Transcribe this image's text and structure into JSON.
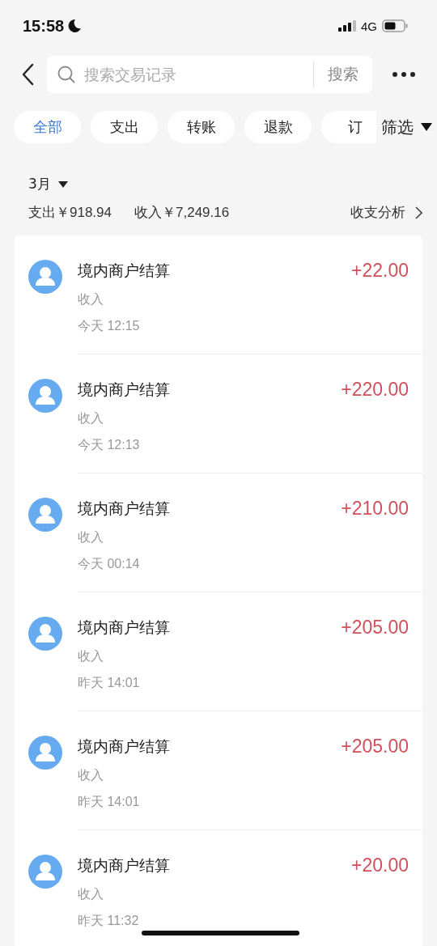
{
  "status_bar": {
    "time": "15:58",
    "network": "4G"
  },
  "search": {
    "placeholder": "搜索交易记录",
    "button": "搜索"
  },
  "filters": [
    {
      "label": "全部",
      "selected": true
    },
    {
      "label": "支出",
      "selected": false
    },
    {
      "label": "转账",
      "selected": false
    },
    {
      "label": "退款",
      "selected": false
    },
    {
      "label": "订",
      "selected": false
    }
  ],
  "filter_menu": "筛选",
  "summary": {
    "month": "3月",
    "expense": "支出￥918.94",
    "income": "收入￥7,249.16",
    "analysis": "收支分析"
  },
  "transactions": [
    {
      "title": "境内商户结算",
      "type": "收入",
      "time": "今天 12:15",
      "amount": "+22.00"
    },
    {
      "title": "境内商户结算",
      "type": "收入",
      "time": "今天 12:13",
      "amount": "+220.00"
    },
    {
      "title": "境内商户结算",
      "type": "收入",
      "time": "今天 00:14",
      "amount": "+210.00"
    },
    {
      "title": "境内商户结算",
      "type": "收入",
      "time": "昨天 14:01",
      "amount": "+205.00"
    },
    {
      "title": "境内商户结算",
      "type": "收入",
      "time": "昨天 14:01",
      "amount": "+205.00"
    },
    {
      "title": "境内商户结算",
      "type": "收入",
      "time": "昨天 11:32",
      "amount": "+20.00"
    }
  ]
}
